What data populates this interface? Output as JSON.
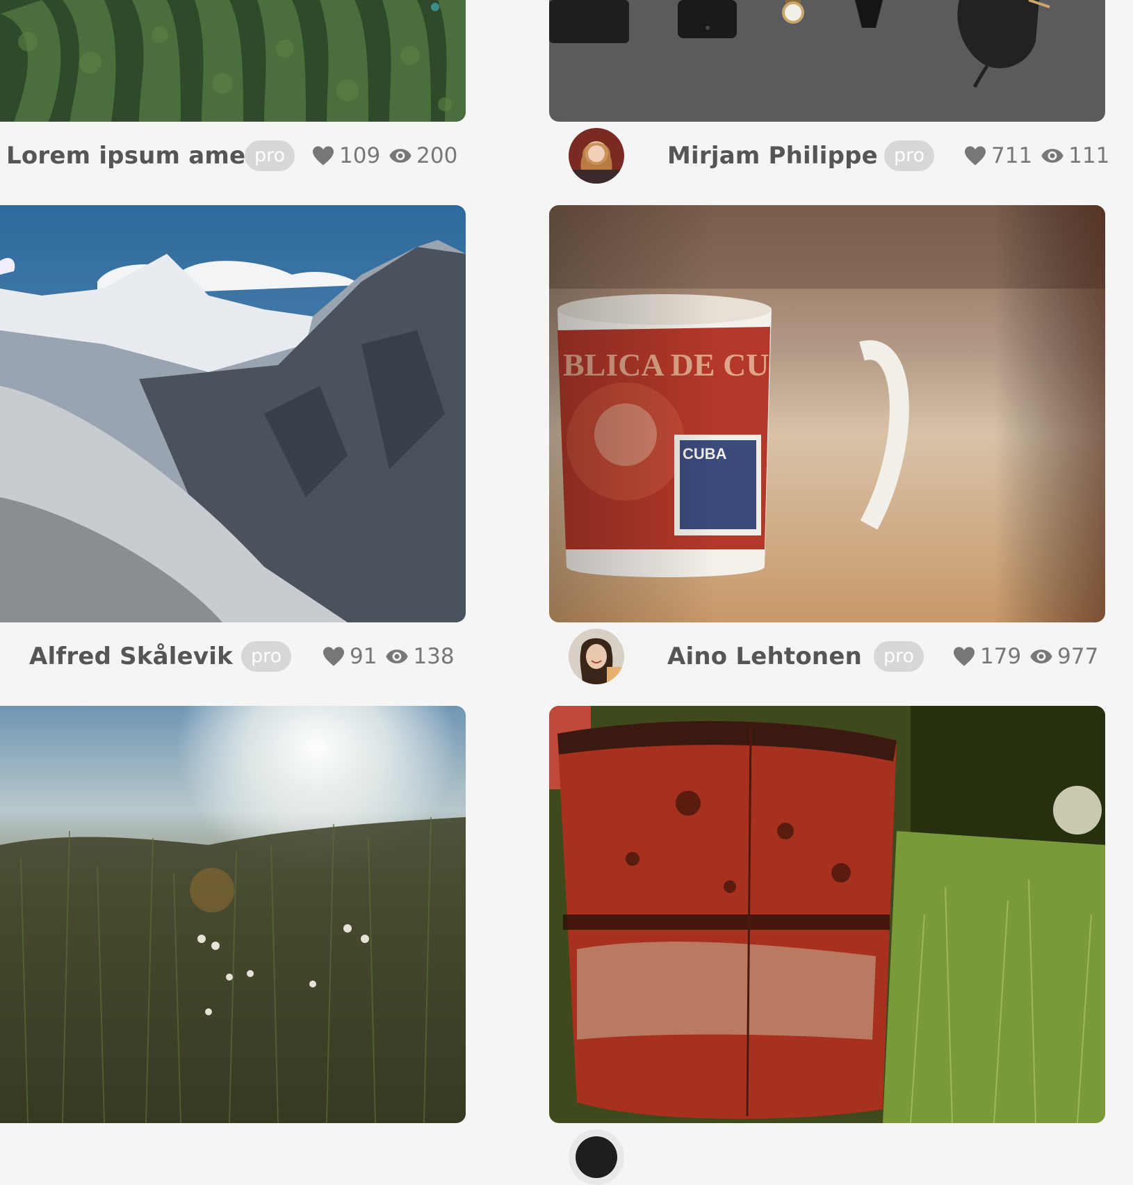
{
  "cards": [
    {
      "name": "Lorem ipsum amet",
      "badge": "pro",
      "likes": "109",
      "views": "200",
      "image": "tea-field-photo"
    },
    {
      "name": "Mirjam Philippe",
      "badge": "pro",
      "likes": "711",
      "views": "111",
      "image": "desk-gadgets-photo"
    },
    {
      "name": "Alfred Skålevik",
      "badge": "pro",
      "likes": "91",
      "views": "138",
      "image": "snowy-mountains-photo"
    },
    {
      "name": "Aino Lehtonen",
      "badge": "pro",
      "likes": "179",
      "views": "977",
      "image": "cuba-mug-photo"
    },
    {
      "image": "meadow-flowers-photo"
    },
    {
      "image": "rusty-barrel-photo"
    }
  ],
  "colors": {
    "background": "#f5f5f5",
    "name_text": "#555555",
    "badge_bg": "#d7d7d7",
    "stats_text": "#777777"
  }
}
